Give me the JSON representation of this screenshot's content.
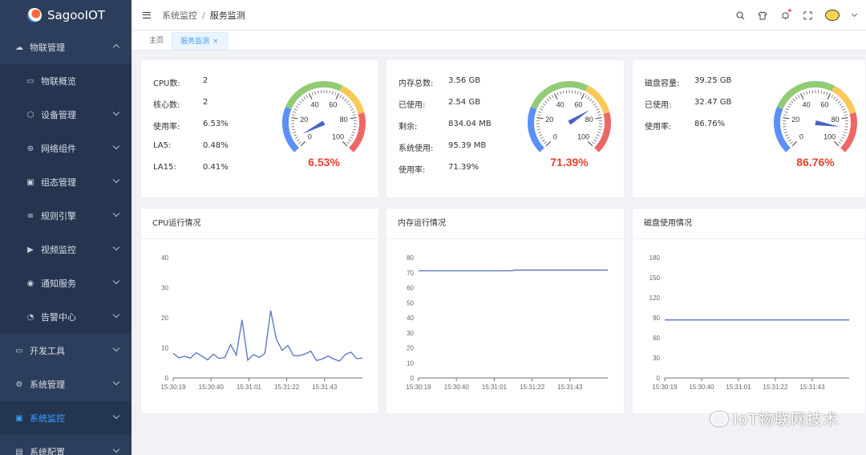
{
  "app": {
    "name": "SagooIOT"
  },
  "sidebar": {
    "items": [
      {
        "label": "物联管理",
        "icon": "cloud-icon",
        "level": 1,
        "expanded": true
      },
      {
        "label": "物联概览",
        "icon": "monitor-icon",
        "level": 2
      },
      {
        "label": "设备管理",
        "icon": "device-icon",
        "level": 2,
        "chevron": true
      },
      {
        "label": "网络组件",
        "icon": "network-icon",
        "level": 2,
        "chevron": true
      },
      {
        "label": "组态管理",
        "icon": "config-icon",
        "level": 2,
        "chevron": true
      },
      {
        "label": "规则引擎",
        "icon": "rule-icon",
        "level": 2,
        "chevron": true
      },
      {
        "label": "视频监控",
        "icon": "video-icon",
        "level": 2,
        "chevron": true
      },
      {
        "label": "通知服务",
        "icon": "broadcast-icon",
        "level": 2,
        "chevron": true
      },
      {
        "label": "告警中心",
        "icon": "alarm-icon",
        "level": 2,
        "chevron": true
      },
      {
        "label": "开发工具",
        "icon": "tool-icon",
        "level": 1,
        "chevron": true
      },
      {
        "label": "系统管理",
        "icon": "gear-icon",
        "level": 1,
        "chevron": true
      },
      {
        "label": "系统监控",
        "icon": "monitor-chart-icon",
        "level": 1,
        "chevron": true,
        "active": true
      },
      {
        "label": "系统配置",
        "icon": "settings-icon",
        "level": 1,
        "chevron": true
      }
    ]
  },
  "header": {
    "breadcrumb": [
      "系统监控",
      "服务监测"
    ],
    "icons": [
      "search-icon",
      "shirt-icon",
      "bell-icon",
      "fullscreen-icon"
    ]
  },
  "tabs": [
    {
      "label": "主页",
      "active": false
    },
    {
      "label": "服务监测",
      "active": true,
      "close": "×"
    }
  ],
  "cpu": {
    "rows": [
      {
        "k": "CPU数:",
        "v": "2"
      },
      {
        "k": "核心数:",
        "v": "2"
      },
      {
        "k": "使用率:",
        "v": "6.53%"
      },
      {
        "k": "LA5:",
        "v": "0.48%"
      },
      {
        "k": "LA15:",
        "v": "0.41%"
      }
    ],
    "gauge_value": 6.53,
    "gauge_label": "6.53%"
  },
  "memory": {
    "rows": [
      {
        "k": "内存总数:",
        "v": "3.56 GB"
      },
      {
        "k": "已使用:",
        "v": "2.54 GB"
      },
      {
        "k": "剩余:",
        "v": "834.04 MB"
      },
      {
        "k": "系统使用:",
        "v": "95.39 MB"
      },
      {
        "k": "使用率:",
        "v": "71.39%"
      }
    ],
    "gauge_value": 71.39,
    "gauge_label": "71.39%"
  },
  "disk": {
    "rows": [
      {
        "k": "磁盘容量:",
        "v": "39.25 GB"
      },
      {
        "k": "已使用:",
        "v": "32.47 GB"
      },
      {
        "k": "使用率:",
        "v": "86.76%"
      }
    ],
    "gauge_value": 86.76,
    "gauge_label": "86.76%"
  },
  "gauge_ticks": [
    "0",
    "20",
    "40",
    "60",
    "80",
    "100"
  ],
  "colors": {
    "accent": "#409eff",
    "gauge_green": "#91cc75",
    "gauge_yellow": "#fac858",
    "gauge_red": "#ee6666",
    "gauge_blue": "#5b8ff9",
    "value_red": "#e8412c",
    "line": "#5470c6"
  },
  "chart_data": [
    {
      "type": "line",
      "title": "CPU运行情况",
      "x": [
        "15:30:19",
        "",
        "",
        "",
        "",
        "",
        "",
        "",
        "",
        "",
        "",
        "",
        "",
        "",
        "",
        "15:31:01",
        "",
        "",
        "",
        "",
        "",
        "",
        "",
        "",
        "",
        "",
        "",
        "",
        "",
        "15:31:43",
        "",
        "",
        ""
      ],
      "xticks": [
        "15:30:19",
        "15:30:40",
        "15:31:01",
        "15:31:22",
        "15:31:43"
      ],
      "yticks": [
        "0",
        "10",
        "20",
        "30",
        "40"
      ],
      "ylim": [
        0,
        40
      ],
      "values": [
        8.2,
        6.7,
        7.2,
        6.6,
        8.4,
        7.3,
        6.0,
        7.9,
        6.5,
        6.8,
        11.1,
        7.6,
        19.3,
        5.9,
        7.8,
        6.8,
        8.2,
        22.4,
        12.8,
        9.2,
        10.8,
        7.4,
        7.4,
        8.0,
        8.9,
        5.8,
        6.3,
        7.3,
        6.3,
        5.6,
        7.8,
        8.6,
        6.4,
        6.6
      ]
    },
    {
      "type": "line",
      "title": "内存运行情况",
      "xticks": [
        "15:30:19",
        "15:30:40",
        "15:31:01",
        "15:31:22",
        "15:31:43"
      ],
      "yticks": [
        "0",
        "10",
        "20",
        "30",
        "40",
        "50",
        "60",
        "70",
        "80"
      ],
      "ylim": [
        0,
        80
      ],
      "values": [
        71.2,
        71.2,
        71.2,
        71.2,
        71.2,
        71.2,
        71.2,
        71.2,
        71.2,
        71.2,
        71.2,
        71.2,
        71.2,
        71.2,
        71.2,
        71.2,
        71.2,
        71.7,
        71.7,
        71.7,
        71.7,
        71.7,
        71.7,
        71.7,
        71.7,
        71.7,
        71.7,
        71.7,
        71.7,
        71.7,
        71.7,
        71.7,
        71.7,
        71.7
      ]
    },
    {
      "type": "line",
      "title": "磁盘使用情况",
      "xticks": [
        "15:30:19",
        "15:30:40",
        "15:31:01",
        "15:31:22",
        "15:31:43"
      ],
      "yticks": [
        "0",
        "30",
        "60",
        "90",
        "120",
        "150",
        "180"
      ],
      "ylim": [
        0,
        180
      ],
      "values": [
        86.8,
        86.8,
        86.8,
        86.8,
        86.8,
        86.8,
        86.8,
        86.8,
        86.8,
        86.8,
        86.8,
        86.8,
        86.8,
        86.8,
        86.8,
        86.8,
        86.8,
        86.8,
        86.8,
        86.8,
        86.8,
        86.8,
        86.8,
        86.8,
        86.8,
        86.8,
        86.8,
        86.8,
        86.8,
        86.8,
        86.8,
        86.8,
        86.8,
        86.8
      ]
    }
  ],
  "watermark": "IoT物联网技术"
}
